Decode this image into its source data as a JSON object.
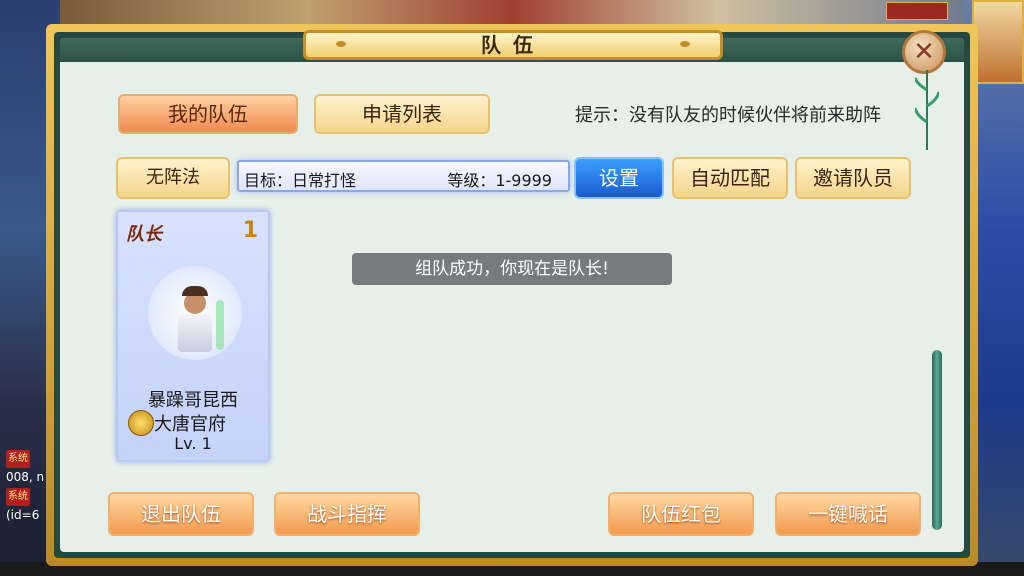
{
  "window": {
    "title": "队伍",
    "close_symbol": "✕"
  },
  "tabs": [
    {
      "label": "我的队伍",
      "active": true
    },
    {
      "label": "申请列表",
      "active": false
    }
  ],
  "hint": "提示：没有队友的时候伙伴将前来助阵",
  "toolbar": {
    "formation_label": "无阵法",
    "target_label": "目标：日常打怪",
    "level_label": "等级：1-9999",
    "settings_label": "设置",
    "auto_match_label": "自动匹配",
    "invite_label": "邀请队员"
  },
  "member_card": {
    "role": "队长",
    "slot_number": "1",
    "name": "暴躁哥昆西",
    "faction": "大唐官府",
    "level": "Lv. 1"
  },
  "toast": "组队成功，你现在是队长!",
  "bottom_buttons": {
    "leave_team": "退出队伍",
    "battle_command": "战斗指挥",
    "team_red_packet": "队伍红包",
    "one_click_shout": "一键喊话"
  },
  "background_chat": {
    "tag": "系统",
    "line1": "008, n",
    "line2": "(id=6"
  },
  "colors": {
    "panel_bg": "#e6efe8",
    "frame_gold": "#f0c75a",
    "accent_blue": "#1a5ad0",
    "accent_orange": "#f29a50"
  }
}
